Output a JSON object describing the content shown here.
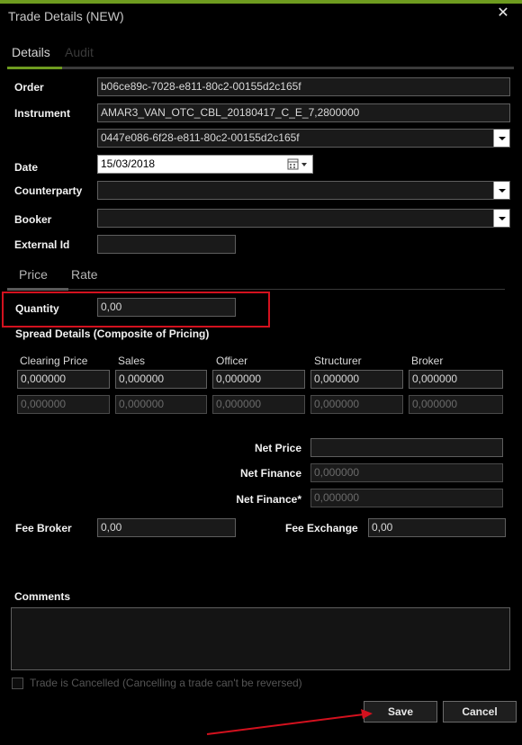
{
  "window": {
    "title": "Trade Details (NEW)",
    "close_icon": "close-icon"
  },
  "tabs": [
    {
      "label": "Details",
      "active": true
    },
    {
      "label": "Audit",
      "active": false
    }
  ],
  "form": {
    "order_label": "Order",
    "order_value": "b06ce89c-7028-e811-80c2-00155d2c165f",
    "instrument_label": "Instrument",
    "instrument_value": "AMAR3_VAN_OTC_CBL_20180417_C_E_7,2800000",
    "instrument_id_value": "0447e086-6f28-e811-80c2-00155d2c165f",
    "date_label": "Date",
    "date_value": "15/03/2018",
    "counterparty_label": "Counterparty",
    "counterparty_value": "",
    "booker_label": "Booker",
    "booker_value": "",
    "external_id_label": "External Id",
    "external_id_value": ""
  },
  "subtabs": [
    {
      "label": "Price",
      "active": true
    },
    {
      "label": "Rate",
      "active": false
    }
  ],
  "quantity": {
    "label": "Quantity",
    "value": "0,00"
  },
  "spread": {
    "title": "Spread Details (Composite of Pricing)",
    "columns": [
      "Clearing Price",
      "Sales",
      "Officer",
      "Structurer",
      "Broker"
    ],
    "row1": [
      "0,000000",
      "0,000000",
      "0,000000",
      "0,000000",
      "0,000000"
    ],
    "row2": [
      "0,000000",
      "0,000000",
      "0,000000",
      "0,000000",
      "0,000000"
    ]
  },
  "net": {
    "net_price_label": "Net Price",
    "net_price_value": "",
    "net_finance_label": "Net Finance",
    "net_finance_value": "0,000000",
    "net_finance_star_label": "Net Finance*",
    "net_finance_star_value": "0,000000"
  },
  "fees": {
    "fee_broker_label": "Fee Broker",
    "fee_broker_value": "0,00",
    "fee_exchange_label": "Fee Exchange",
    "fee_exchange_value": "0,00"
  },
  "comments": {
    "label": "Comments",
    "value": ""
  },
  "cancel_checkbox": {
    "label": "Trade is Cancelled (Cancelling a trade can't be reversed)",
    "checked": false
  },
  "buttons": {
    "save_label": "Save",
    "cancel_label": "Cancel"
  },
  "colors": {
    "accent": "#6e9b1f",
    "highlight": "#d3111e",
    "background": "#000000"
  }
}
